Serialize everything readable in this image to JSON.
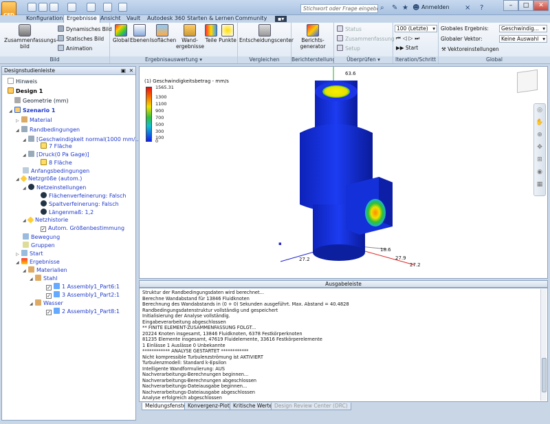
{
  "app": {
    "logo_text": "CFD",
    "search_placeholder": "Stichwort oder Frage eingeben",
    "sign_in": "Anmelden"
  },
  "tabs": [
    "Konfiguration",
    "Ergebnisse",
    "Ansicht",
    "Vault",
    "Autodesk 360",
    "Starten & Lernen",
    "Community"
  ],
  "ribbon": {
    "bild": {
      "label": "Bild",
      "summary": "Zusammenfassungs-\nbild",
      "dyn": "Dynamisches Bild",
      "static": "Statisches Bild",
      "anim": "Animation"
    },
    "auswertung": {
      "label": "Ergebnisauswertung",
      "buttons": [
        "Global",
        "Ebenen",
        "Isoflächen",
        "Wand-\nergebnisse",
        "Teile",
        "Punkte"
      ]
    },
    "vergleichen": {
      "label": "Vergleichen",
      "button": "Entscheidungscenter"
    },
    "bericht": {
      "label": "Berichterstellung",
      "button": "Berichts-\ngenerator"
    },
    "ueberpruefen": {
      "label": "Überprüfen",
      "status": "Status",
      "zusammenfassung": "Zusammenfassung",
      "setup": "Setup"
    },
    "iteration": {
      "label": "Iteration/Schritt",
      "select": "100 (Letzte)",
      "start": "Start"
    },
    "global": {
      "label": "Global",
      "result_label": "Globales Ergebnis:",
      "result_value": "Geschwindig...",
      "vector_label": "Globaler Vektor:",
      "vector_value": "Keine Auswahl",
      "vector_settings": "Vektoreinstellungen"
    }
  },
  "left_panel": {
    "title": "Designstudienleiste",
    "nodes": [
      "Hinweis",
      "Design 1",
      "Geometrie (mm)",
      "Szenario 1",
      "Material",
      "Randbedingungen",
      "[Geschwindigkeit normal(1000 mm/...",
      "7 Fläche",
      "[Druck(0 Pa Gage)]",
      "8 Fläche",
      "Anfangsbedingungen",
      "Netzgröße (autom.)",
      "Netzeinstellungen",
      "Flächenverfeinerung: Falsch",
      "Spaltverfeinerung: Falsch",
      "Längenmaß: 1,2",
      "Netzhistorie",
      "Autom. Größenbestimmung",
      "Bewegung",
      "Gruppen",
      "Start",
      "Ergebnisse",
      "Materialien",
      "Stahl",
      "1 Assembly1_Part6:1",
      "3 Assembly1_Part2:1",
      "Wasser",
      "2 Assembly1_Part8:1"
    ]
  },
  "viewport": {
    "legend_title": "(1) Geschwindigkeitsbetrag - mm/s",
    "legend_max": "1565.31",
    "legend_ticks": [
      "1300",
      "1100",
      "900",
      "700",
      "500",
      "300",
      "100",
      "0"
    ],
    "colors": {
      "body": "#1430e0",
      "legend_top": "#e81010",
      "legend_bottom": "#1020f0"
    },
    "axis_labels": [
      "63.6",
      "18.6",
      "27.9",
      "27.2",
      "27.2"
    ]
  },
  "output": {
    "title": "Ausgabeleiste",
    "lines": [
      "Struktur der Randbedingungsdaten wird berechnet...",
      "Berechne Wandabstand für 13846 Fluidknoten",
      "Berechnung des Wandabstands in (0 + 0) Sekunden ausgeführt. Max. Abstand = 40.4828",
      "Randbedingungsdatenstruktur vollständig und gespeichert",
      "Initialisierung der Analyse vollständig.",
      "Eingabeverarbeitung abgeschlossen",
      "** FINITE ELEMENT-ZUSAMMENFASSUNG FOLGT...",
      "20224 Knoten insgesamt,    13846 Fluidknoten,    6378 Festkörperknoten",
      "81235 Elemente insgesamt,   47619 Fluidelemente,    33616 Festkörperelemente",
      "1 Einlässe   1 Auslässe    0 Unbekannte",
      "************ ANALYSE GESTARTET ************",
      "Nicht kompressible Turbulenzströmung ist AKTIVIERT",
      "Turbulenzmodell: Standard k-Epsilon",
      "Intelligente Wandformulierung: AUS",
      "Nachverarbeitungs-Berechnungen beginnen...",
      "Nachverarbeitungs-Berechnungen abgeschlossen",
      "Nachverarbeitungs-Dateiausgabe beginnen...",
      "Nachverarbeitungs-Dateiausgabe abgeschlossen",
      "Analyse erfolgreich abgeschlossen"
    ],
    "tabs": [
      "Meldungsfenster",
      "Konvergenz-Plot",
      "Kritische Werte",
      "Design Review Center (DRC)"
    ]
  }
}
